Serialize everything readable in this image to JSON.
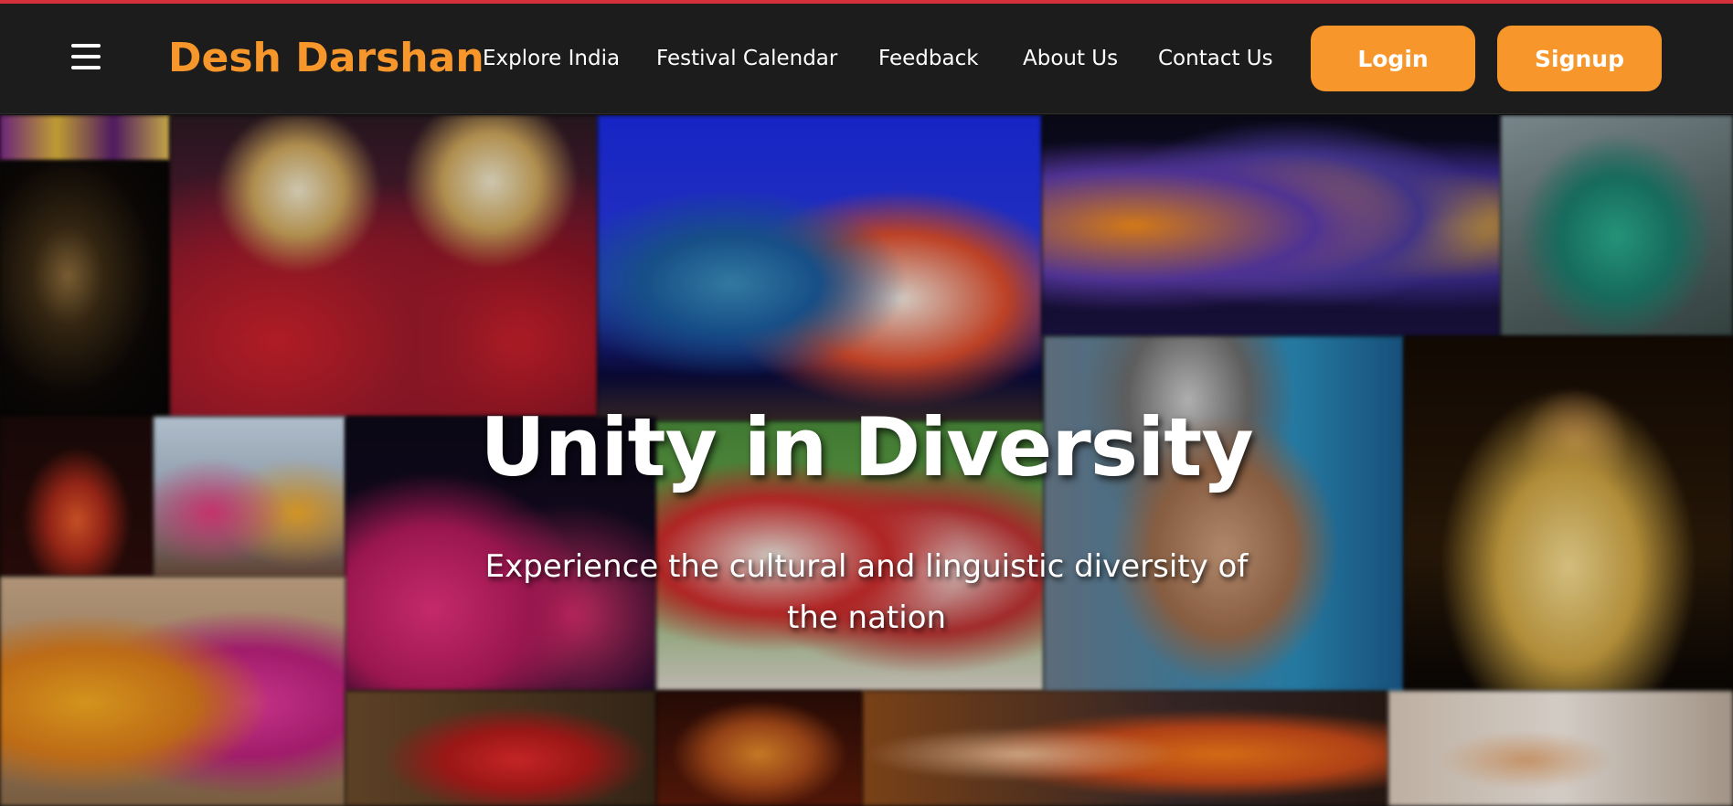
{
  "brand": {
    "name": "Desh Darshan",
    "color": "#f7962a"
  },
  "nav": {
    "menu_icon": "hamburger-menu-icon",
    "links": [
      {
        "label": "Explore India"
      },
      {
        "label": "Festival Calendar"
      },
      {
        "label": "Feedback"
      },
      {
        "label": "About Us"
      },
      {
        "label": "Contact Us"
      }
    ],
    "login_label": "Login",
    "signup_label": "Signup"
  },
  "hero": {
    "title": "Unity in Diversity",
    "subtitle": "Experience the cultural and linguistic diversity of the nation"
  },
  "colors": {
    "accent": "#f7962a",
    "navbar": "#1c1c1c",
    "top_border": "#d4303a"
  }
}
